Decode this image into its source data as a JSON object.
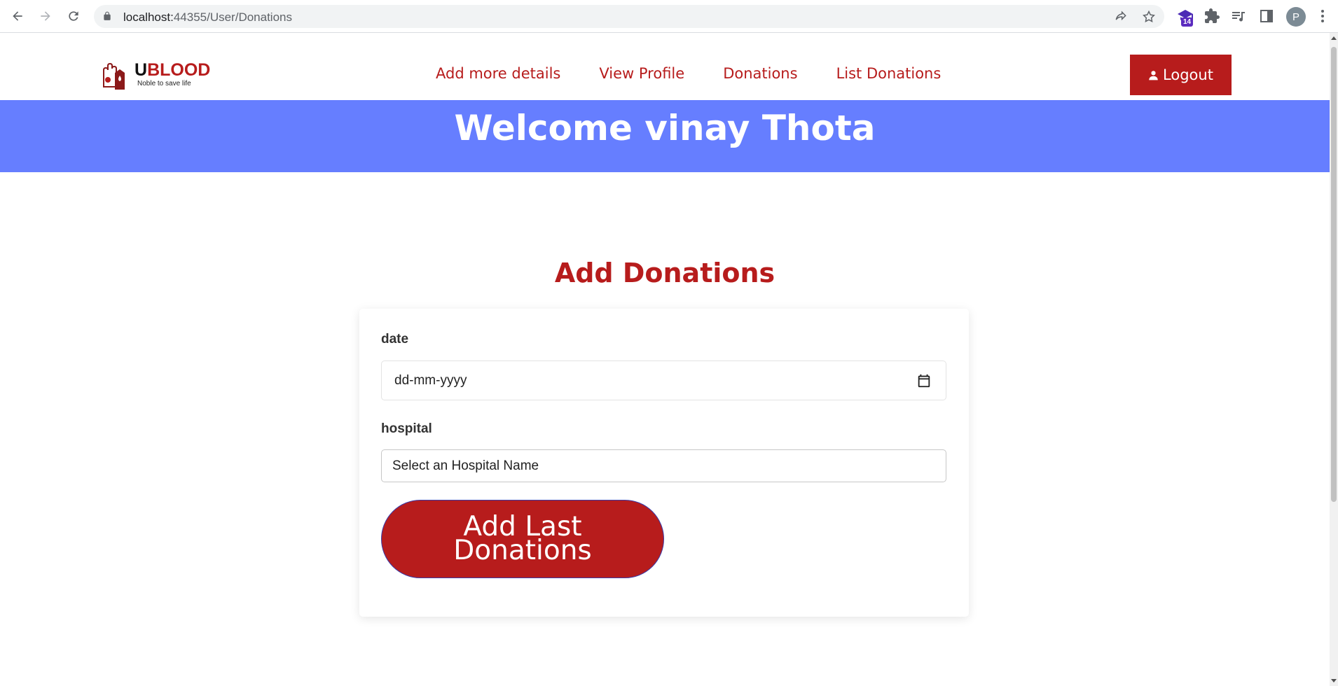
{
  "browser": {
    "url_host": "localhost:",
    "url_path": "44355/User/Donations",
    "extension_badge": "14",
    "profile_initial": "P"
  },
  "header": {
    "logo": {
      "brand_first": "U",
      "brand_rest": "BLOOD",
      "tagline": "Noble to save life"
    },
    "nav": [
      {
        "label": "Add more details"
      },
      {
        "label": "View Profile"
      },
      {
        "label": "Donations"
      },
      {
        "label": "List Donations"
      }
    ],
    "logout_label": "Logout"
  },
  "banner": {
    "welcome_text": "Welcome vinay Thota"
  },
  "form": {
    "title": "Add Donations",
    "date_label": "date",
    "date_value": "dd-mm-yyyy",
    "hospital_label": "hospital",
    "hospital_value": "Select an Hospital Name",
    "submit_label": "Add Last Donations"
  },
  "colors": {
    "brand_red": "#b71c1c",
    "banner_blue": "#667eff"
  }
}
